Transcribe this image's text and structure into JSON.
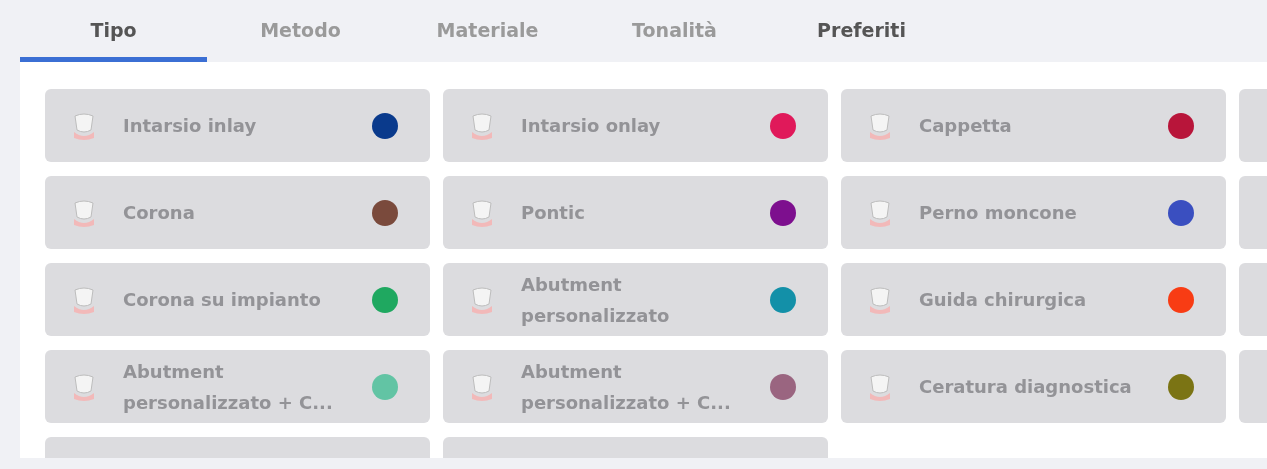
{
  "tabs": [
    {
      "label": "Tipo",
      "selected": true,
      "disabled": false
    },
    {
      "label": "Metodo",
      "selected": false,
      "disabled": true
    },
    {
      "label": "Materiale",
      "selected": false,
      "disabled": true
    },
    {
      "label": "Tonalità",
      "selected": false,
      "disabled": true
    },
    {
      "label": "Preferiti",
      "selected": false,
      "disabled": false
    }
  ],
  "cards": [
    {
      "kind": "full",
      "label": "Intarsio inlay",
      "color": "#0a3a8c"
    },
    {
      "kind": "full",
      "label": "Intarsio onlay",
      "color": "#e0195a"
    },
    {
      "kind": "full",
      "label": "Cappetta",
      "color": "#b8153a"
    },
    {
      "kind": "partial"
    },
    {
      "kind": "full",
      "label": "Corona",
      "color": "#7a4a3c"
    },
    {
      "kind": "full",
      "label": "Pontic",
      "color": "#7d0f8e"
    },
    {
      "kind": "full",
      "label": "Perno moncone",
      "color": "#3a4fc0"
    },
    {
      "kind": "partial"
    },
    {
      "kind": "full",
      "label": "Corona su impianto",
      "color": "#1fa860"
    },
    {
      "kind": "full",
      "label": "Abutment personalizzato",
      "color": "#1390a8"
    },
    {
      "kind": "full",
      "label": "Guida chirurgica",
      "color": "#f83c14"
    },
    {
      "kind": "partial"
    },
    {
      "kind": "full",
      "label": "Abutment personalizzato + C...",
      "color": "#62c4a4"
    },
    {
      "kind": "full",
      "label": "Abutment personalizzato + C...",
      "color": "#9a6580"
    },
    {
      "kind": "full",
      "label": "Ceratura diagnostica",
      "color": "#7b7414"
    },
    {
      "kind": "partial"
    },
    {
      "kind": "partial"
    },
    {
      "kind": "partial"
    }
  ]
}
